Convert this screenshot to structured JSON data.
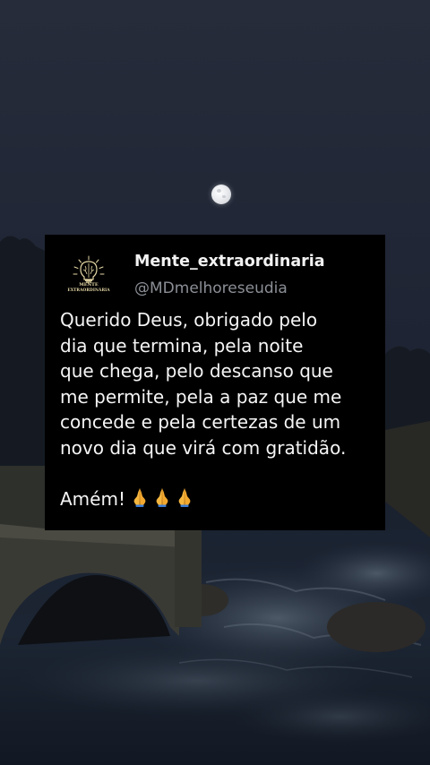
{
  "post": {
    "display_name": "Mente_extraordinaria",
    "handle": "@MDmelhoreseudia",
    "avatar": {
      "icon": "lightbulb-brain-icon",
      "line1": "MENTE",
      "line2": "EXTRAORDINÁRIA"
    },
    "body_lines": [
      "Querido Deus, obrigado pelo",
      "dia que termina, pela noite",
      "que chega, pelo descanso que",
      "me permite, pela a paz que me",
      "concede e pela certezas de um",
      "novo dia que virá com gratidão."
    ],
    "closing": "Amém!",
    "closing_emojis": [
      "folded-hands-emoji",
      "folded-hands-emoji",
      "folded-hands-emoji"
    ]
  },
  "colors": {
    "card_background": "#000000",
    "display_name": "#f2f2f2",
    "handle": "#8b8f96",
    "body_text": "#f5f5f5",
    "sky": "#1f2636",
    "avatar_gold": "#e6d9a6"
  }
}
